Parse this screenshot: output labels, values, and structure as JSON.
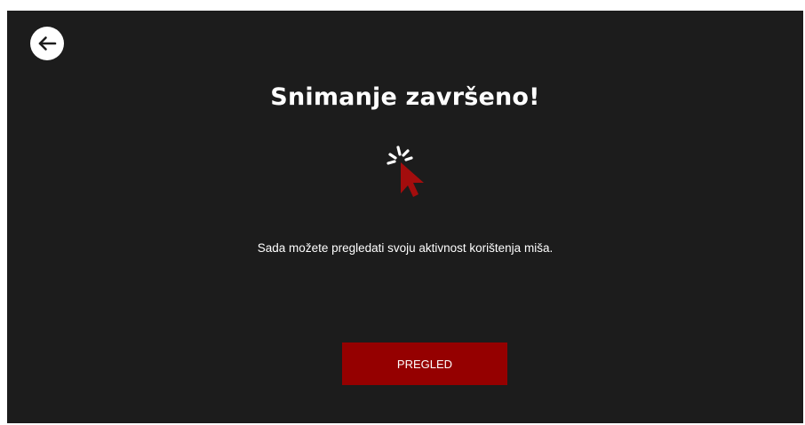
{
  "header": {
    "back_icon": "arrow-left-icon"
  },
  "main": {
    "title": "Snimanje završeno!",
    "illustration_icon": "cursor-click-icon",
    "message": "Sada možete pregledati svoju aktivnost korištenja miša.",
    "review_button_label": "PREGLED"
  },
  "colors": {
    "background": "#1c1c1c",
    "accent": "#950000",
    "cursor": "#a30d0d",
    "text": "#ffffff"
  }
}
